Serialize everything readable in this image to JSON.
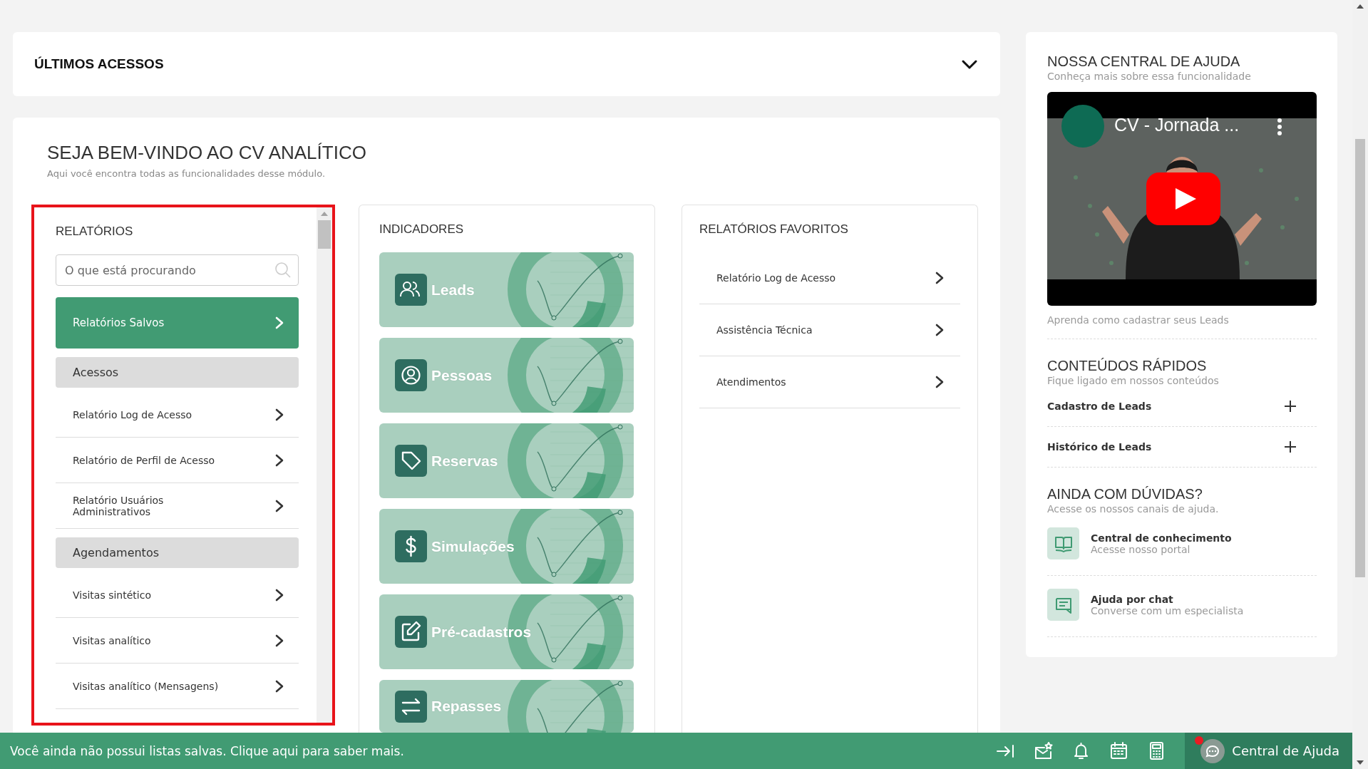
{
  "recent_access": {
    "title": "ÚLTIMOS ACESSOS",
    "expanded": false
  },
  "welcome": {
    "title": "SEJA BEM-VINDO AO CV ANALÍTICO",
    "subtitle": "Aqui você encontra todas as funcionalidades desse módulo."
  },
  "reports": {
    "title": "RELATÓRIOS",
    "highlighted": true,
    "search": {
      "placeholder": "O que está procurando"
    },
    "saved_button": "Relatórios Salvos",
    "items": [
      {
        "kind": "group",
        "label": "Acessos"
      },
      {
        "kind": "link",
        "label": "Relatório Log de Acesso"
      },
      {
        "kind": "link",
        "label": "Relatório de Perfil de Acesso"
      },
      {
        "kind": "link",
        "label": "Relatório Usuários Administrativos"
      },
      {
        "kind": "group",
        "label": "Agendamentos"
      },
      {
        "kind": "link",
        "label": "Visitas sintético"
      },
      {
        "kind": "link",
        "label": "Visitas analítico"
      },
      {
        "kind": "link",
        "label": "Visitas analítico (Mensagens)"
      }
    ]
  },
  "indicators": {
    "title": "INDICADORES",
    "items": [
      {
        "label": "Leads"
      },
      {
        "label": "Pessoas"
      },
      {
        "label": "Reservas"
      },
      {
        "label": "Simulações"
      },
      {
        "label": "Pré-cadastros"
      },
      {
        "label": "Repasses"
      }
    ]
  },
  "favorites": {
    "title": "RELATÓRIOS FAVORITOS",
    "items": [
      {
        "label": "Relatório Log de Acesso"
      },
      {
        "label": "Assistência Técnica"
      },
      {
        "label": "Atendimentos"
      }
    ]
  },
  "help": {
    "title": "NOSSA CENTRAL DE AJUDA",
    "subtitle": "Conheça mais sobre essa funcionalidade",
    "video": {
      "kind": "picture",
      "title": "CV - Jornada ..."
    },
    "caption": "Aprenda como cadastrar seus Leads",
    "quick": {
      "title": "CONTEÚDOS RÁPIDOS",
      "subtitle": "Fique ligado em nossos conteúdos",
      "items": [
        {
          "label": "Cadastro de Leads",
          "expanded": false
        },
        {
          "label": "Histórico de Leads",
          "expanded": false
        }
      ]
    },
    "doubts": {
      "title": "AINDA COM DÚVIDAS?",
      "subtitle": "Acesse os nossos canais de ajuda.",
      "items": [
        {
          "title": "Central de conhecimento",
          "subtitle": "Acesse nosso portal"
        },
        {
          "title": "Ajuda por chat",
          "subtitle": "Converse com um especialista"
        }
      ]
    }
  },
  "status_bar": {
    "message": "Você ainda não possui listas salvas. Clique aqui para saber mais.",
    "help_label": "Central de Ajuda",
    "unread": true
  }
}
